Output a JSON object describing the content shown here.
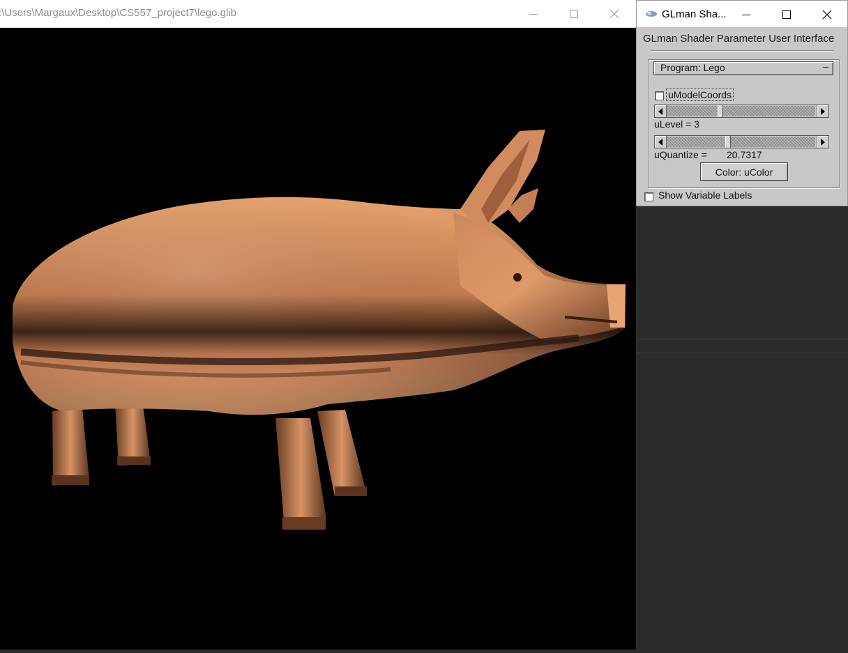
{
  "render_window": {
    "title": ":\\Users\\Margaux\\Desktop\\CS557_project7\\lego.glib",
    "scene": {
      "object": "pig",
      "shading_color": "#e6a06e",
      "background": "#000000"
    }
  },
  "panel_window": {
    "title": "GLman Sha...",
    "heading": "GLman Shader Parameter User Interface",
    "program_rollout": {
      "label": "Program: Lego",
      "toggle": "–"
    },
    "model_coords": {
      "label": "uModelCoords",
      "checked": false
    },
    "level": {
      "label": "uLevel = 3",
      "value": 3
    },
    "quantize": {
      "label": "uQuantize =",
      "value": "20.7317"
    },
    "color_button": "Color: uColor",
    "show_labels": {
      "label": "Show Variable Labels",
      "checked": false
    }
  },
  "colors": {
    "panel_gray": "#c8c8c8",
    "pig_color": "#e6a06e"
  }
}
